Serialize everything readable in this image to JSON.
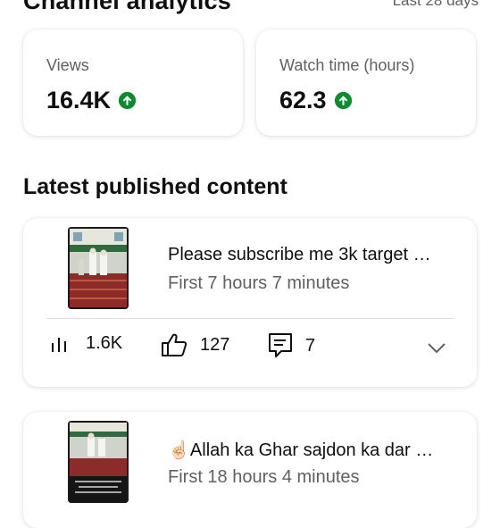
{
  "header": {
    "title": "Channel analytics",
    "period": "Last 28 days"
  },
  "metrics": [
    {
      "label": "Views",
      "value": "16.4K",
      "trend": "up"
    },
    {
      "label": "Watch time (hours)",
      "value": "62.3",
      "trend": "up"
    }
  ],
  "latest": {
    "title": "Latest published content",
    "items": [
      {
        "title": "Please subscribe me 3k target …",
        "subtitle": "First 7 hours 7 minutes",
        "views": "1.6K",
        "likes": "127",
        "comments": "7"
      },
      {
        "emoji": "☝🏻",
        "title": "Allah ka Ghar sajdon ka dar …",
        "subtitle": "First 18 hours 4 minutes"
      }
    ]
  },
  "colors": {
    "trend_up": "#0f8a2e",
    "secondary_text": "#606060"
  }
}
